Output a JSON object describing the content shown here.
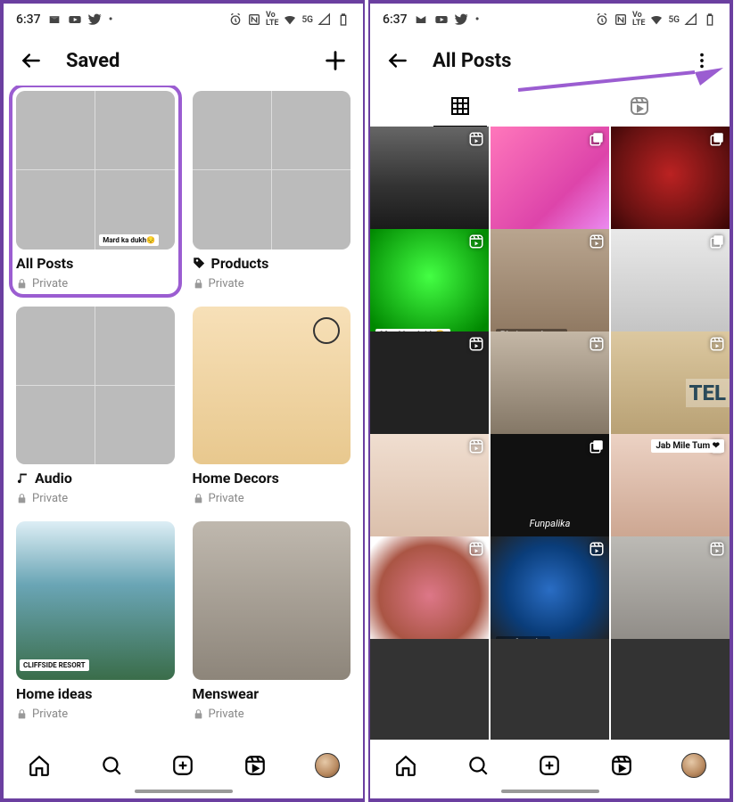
{
  "status": {
    "time": "6:37",
    "network_label": "5G"
  },
  "left_screen": {
    "header_title": "Saved",
    "collections": [
      {
        "title": "All Posts",
        "privacy": "Private",
        "highlight": true,
        "overlay": "Mard ka dukh😔"
      },
      {
        "title": "Products",
        "privacy": "Private",
        "tag_icon": true
      },
      {
        "title": "Audio",
        "privacy": "Private",
        "music_icon": true
      },
      {
        "title": "Home Decors",
        "privacy": "Private"
      },
      {
        "title": "Home ideas",
        "privacy": "Private",
        "overlay": "CLIFFSIDE RESORT"
      },
      {
        "title": "Menswear",
        "privacy": "Private"
      }
    ]
  },
  "right_screen": {
    "header_title": "All Posts",
    "posts": [
      {
        "cls": "p-car",
        "indicator": "reel"
      },
      {
        "cls": "p-pink",
        "indicator": "multi"
      },
      {
        "cls": "p-armor",
        "indicator": "multi"
      },
      {
        "cls": "p-green",
        "indicator": "reel",
        "caption": "Mard ka dukh😬"
      },
      {
        "cls": "p-guy1",
        "indicator": "reel",
        "caption": "Bhai mereko na",
        "cap_dark": true
      },
      {
        "cls": "p-bike",
        "indicator": "multi"
      },
      {
        "cls": "p-pov",
        "indicator": "reel",
        "caption": ""
      },
      {
        "cls": "p-mirror",
        "indicator": "reel"
      },
      {
        "cls": "p-tel",
        "indicator": "reel",
        "tel": "TEL"
      },
      {
        "cls": "p-face",
        "indicator": "reel"
      },
      {
        "cls": "p-meme",
        "indicator": "multi",
        "funp": "Funpalika"
      },
      {
        "cls": "p-couple",
        "indicator": "reel",
        "caption": "Jab Mile Tum ❤",
        "cap_top": true
      },
      {
        "cls": "p-food",
        "indicator": "reel"
      },
      {
        "cls": "p-globe",
        "indicator": "reel",
        "caption": "my favorite",
        "cap_dark": true
      },
      {
        "cls": "p-rock",
        "indicator": "reel"
      },
      {
        "cls": "p-dark"
      },
      {
        "cls": "p-dark"
      },
      {
        "cls": "p-dark"
      }
    ]
  }
}
